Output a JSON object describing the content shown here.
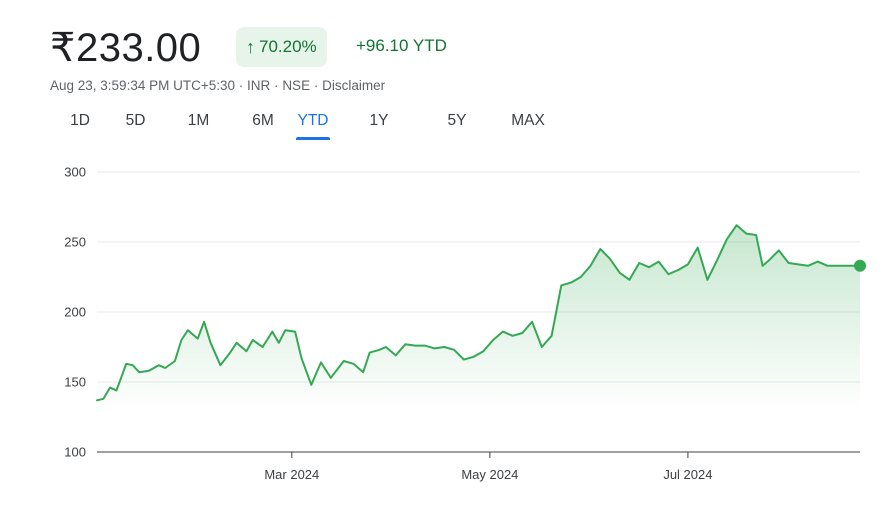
{
  "quote": {
    "price": "₹233.00",
    "change_pct": "70.20%",
    "change_abs": "+96.10 YTD",
    "timestamp": "Aug 23, 3:59:34 PM UTC+5:30",
    "currency": "INR",
    "exchange": "NSE",
    "disclaimer": "Disclaimer",
    "separator": "·"
  },
  "range_tabs": [
    {
      "label": "1D"
    },
    {
      "label": "5D"
    },
    {
      "label": "1M"
    },
    {
      "label": "6M"
    },
    {
      "label": "YTD",
      "active": true
    },
    {
      "label": "1Y"
    },
    {
      "label": "5Y"
    },
    {
      "label": "MAX"
    }
  ],
  "colors": {
    "line": "#34a853",
    "area_top": "#34a853",
    "positive_text": "#137333",
    "positive_bg": "#e6f4ea",
    "active_tab": "#1a73e8",
    "grid": "#e8eaed",
    "axis": "#3c4043"
  },
  "chart_data": {
    "type": "area",
    "ylim": [
      100,
      300
    ],
    "yticks": [
      100,
      150,
      200,
      250,
      300
    ],
    "xlim": [
      "2024-01-01",
      "2024-08-23"
    ],
    "xticks": [
      {
        "date": "2024-03-01",
        "label": "Mar 2024"
      },
      {
        "date": "2024-05-01",
        "label": "May 2024"
      },
      {
        "date": "2024-07-01",
        "label": "Jul 2024"
      }
    ],
    "grid": true,
    "legend": "none",
    "series": [
      {
        "x": [
          "2024-01-01",
          "2024-01-03",
          "2024-01-05",
          "2024-01-07",
          "2024-01-10",
          "2024-01-12",
          "2024-01-14",
          "2024-01-17",
          "2024-01-20",
          "2024-01-22",
          "2024-01-25",
          "2024-01-27",
          "2024-01-29",
          "2024-02-01",
          "2024-02-03",
          "2024-02-05",
          "2024-02-08",
          "2024-02-11",
          "2024-02-13",
          "2024-02-16",
          "2024-02-18",
          "2024-02-21",
          "2024-02-24",
          "2024-02-26",
          "2024-02-28",
          "2024-03-02",
          "2024-03-04",
          "2024-03-07",
          "2024-03-10",
          "2024-03-13",
          "2024-03-15",
          "2024-03-17",
          "2024-03-20",
          "2024-03-23",
          "2024-03-25",
          "2024-03-28",
          "2024-03-30",
          "2024-04-02",
          "2024-04-05",
          "2024-04-08",
          "2024-04-11",
          "2024-04-14",
          "2024-04-17",
          "2024-04-20",
          "2024-04-23",
          "2024-04-26",
          "2024-04-29",
          "2024-05-02",
          "2024-05-05",
          "2024-05-08",
          "2024-05-11",
          "2024-05-14",
          "2024-05-17",
          "2024-05-20",
          "2024-05-23",
          "2024-05-26",
          "2024-05-29",
          "2024-06-01",
          "2024-06-04",
          "2024-06-07",
          "2024-06-10",
          "2024-06-13",
          "2024-06-16",
          "2024-06-19",
          "2024-06-22",
          "2024-06-25",
          "2024-06-28",
          "2024-07-01",
          "2024-07-04",
          "2024-07-07",
          "2024-07-10",
          "2024-07-13",
          "2024-07-16",
          "2024-07-19",
          "2024-07-22",
          "2024-07-24",
          "2024-07-26",
          "2024-07-29",
          "2024-08-01",
          "2024-08-04",
          "2024-08-07",
          "2024-08-10",
          "2024-08-13",
          "2024-08-16",
          "2024-08-19",
          "2024-08-21",
          "2024-08-23"
        ],
        "values": [
          136.9,
          138,
          146,
          144,
          163,
          162,
          157,
          158,
          162,
          160,
          165,
          180,
          187,
          181,
          193,
          178,
          162,
          171,
          178,
          172,
          180,
          175,
          186,
          178,
          187,
          186,
          167,
          148,
          164,
          153,
          159,
          165,
          163,
          157,
          171,
          173,
          175,
          169,
          177,
          176,
          176,
          174,
          175,
          173,
          166,
          168,
          172,
          180,
          186,
          183,
          185,
          193,
          175,
          183,
          219,
          221,
          225,
          233,
          245,
          238,
          228,
          223,
          235,
          232,
          236,
          227,
          230,
          234,
          246,
          223,
          237,
          252,
          262,
          256,
          255,
          233,
          237,
          244,
          235,
          234,
          233,
          236,
          233,
          233,
          233,
          233,
          233
        ]
      }
    ]
  }
}
